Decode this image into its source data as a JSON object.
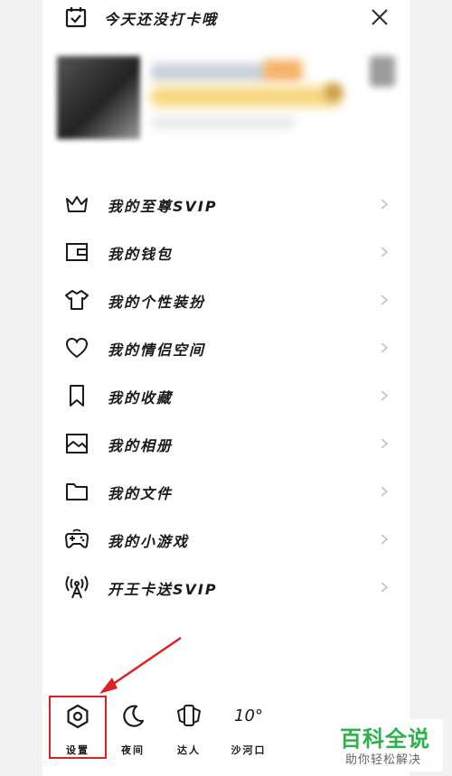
{
  "checkin": {
    "text": "今天还没打卡哦"
  },
  "menu": {
    "items": [
      {
        "label": "我的至尊SVIP",
        "icon": "crown-icon"
      },
      {
        "label": "我的钱包",
        "icon": "wallet-icon"
      },
      {
        "label": "我的个性装扮",
        "icon": "tshirt-icon"
      },
      {
        "label": "我的情侣空间",
        "icon": "heart-icon"
      },
      {
        "label": "我的收藏",
        "icon": "bookmark-icon"
      },
      {
        "label": "我的相册",
        "icon": "photo-icon"
      },
      {
        "label": "我的文件",
        "icon": "folder-icon"
      },
      {
        "label": "我的小游戏",
        "icon": "gamepad-icon"
      },
      {
        "label": "开王卡送SVIP",
        "icon": "signal-tower-icon"
      }
    ]
  },
  "bottom": {
    "settings_label": "设置",
    "night_label": "夜间",
    "expert_label": "达人",
    "weather_temp": "10°",
    "weather_location": "沙河口"
  },
  "watermark": {
    "main": "百科全说",
    "sub": "助你轻松解决"
  },
  "colors": {
    "highlight": "#e02020",
    "watermark_green": "#2bb24c"
  }
}
